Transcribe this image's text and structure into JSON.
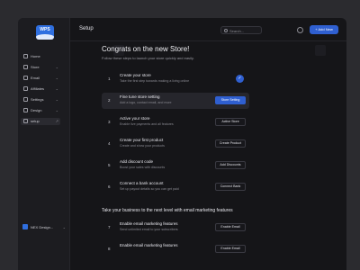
{
  "app": {
    "logo_text": "WPS"
  },
  "sidebar": {
    "items": [
      {
        "label": "Home",
        "chevron": ""
      },
      {
        "label": "Store",
        "chevron": "⌄"
      },
      {
        "label": "Email",
        "chevron": "⌄"
      },
      {
        "label": "Affiliates",
        "chevron": "⌄"
      },
      {
        "label": "Settings",
        "chevron": "⌄"
      },
      {
        "label": "Design",
        "chevron": "⌄"
      },
      {
        "label": "setup",
        "chevron": "↗"
      }
    ],
    "account": {
      "label": "NEX Design...",
      "chevron": "⌄"
    }
  },
  "header": {
    "title": "Setup",
    "search_placeholder": "Search...",
    "add_new_label": "+ Add New"
  },
  "main": {
    "heading": "Congrats on the new Store!",
    "subheading": "Follow these steps to launch your store quickly and easily.",
    "steps": [
      {
        "num": "1",
        "title": "Create your store",
        "desc": "Take the first step towards making a living online",
        "done": true,
        "button": "✓"
      },
      {
        "num": "2",
        "title": "Fine tune store setting",
        "desc": "Add a logo, contact email, and more",
        "button": "Store Setting"
      },
      {
        "num": "3",
        "title": "Active your store",
        "desc": "Enable live payments and all features",
        "button": "Active Store"
      },
      {
        "num": "4",
        "title": "Create your first product",
        "desc": "Create and show your products",
        "button": "Create Product"
      },
      {
        "num": "5",
        "title": "Add discount code",
        "desc": "Boost your sales with discounts",
        "button": "Add Discounts"
      },
      {
        "num": "6",
        "title": "Connect a bank account",
        "desc": "Set up payout details so you can get paid",
        "button": "Connect Bank"
      }
    ],
    "section2_heading": "Take your business to the next level with email marketing features",
    "steps2": [
      {
        "num": "7",
        "title": "Enable email marketing features",
        "desc": "Send unlimited email to your subscribers",
        "button": "Enable Email"
      },
      {
        "num": "8",
        "title": "Enable email marketing features",
        "desc": "",
        "button": "Enable Email"
      }
    ]
  },
  "colors": {
    "accent": "#2f5fd0",
    "background": "#151518",
    "sidebar": "#1c1c20"
  }
}
